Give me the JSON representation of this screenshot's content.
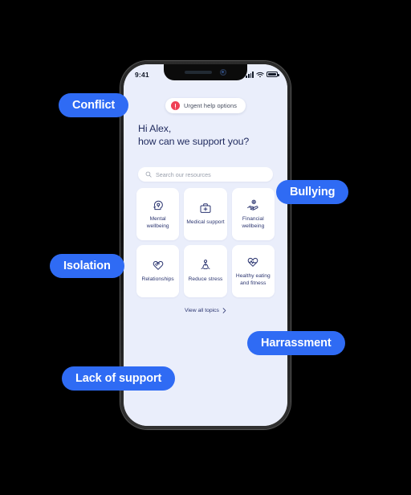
{
  "device": {
    "status_bar": {
      "time": "9:41",
      "signal_icon": "cellular-signal-icon",
      "wifi_icon": "wifi-icon",
      "battery_icon": "battery-full-icon"
    }
  },
  "app": {
    "urgent_banner": {
      "label": "Urgent help options",
      "icon": "alert-exclamation-icon",
      "badge_color": "#ef4056"
    },
    "greeting": {
      "line1": "Hi Alex,",
      "line2": "how can we support you?"
    },
    "search": {
      "placeholder": "Search our resources",
      "value": "",
      "icon": "search-icon"
    },
    "topics": [
      {
        "label": "Mental wellbeing",
        "icon": "head-mind-pin-icon"
      },
      {
        "label": "Medical support",
        "icon": "medical-kit-icon"
      },
      {
        "label": "Financial wellbeing",
        "icon": "hand-coin-icon"
      },
      {
        "label": "Relationships",
        "icon": "heart-handshake-icon"
      },
      {
        "label": "Reduce stress",
        "icon": "meditation-person-icon"
      },
      {
        "label": "Healthy eating and fitness",
        "icon": "heart-pulse-icon"
      }
    ],
    "view_all": {
      "label": "View all topics",
      "icon": "chevron-right-icon"
    },
    "colors": {
      "screen_background": "#eaeefb",
      "card_background": "#ffffff",
      "text_primary": "#2b3570",
      "accent_blue": "#2f6bf4"
    }
  },
  "tags": [
    {
      "label": "Conflict"
    },
    {
      "label": "Bullying"
    },
    {
      "label": "Isolation"
    },
    {
      "label": "Harrassment"
    },
    {
      "label": "Lack of support"
    }
  ]
}
